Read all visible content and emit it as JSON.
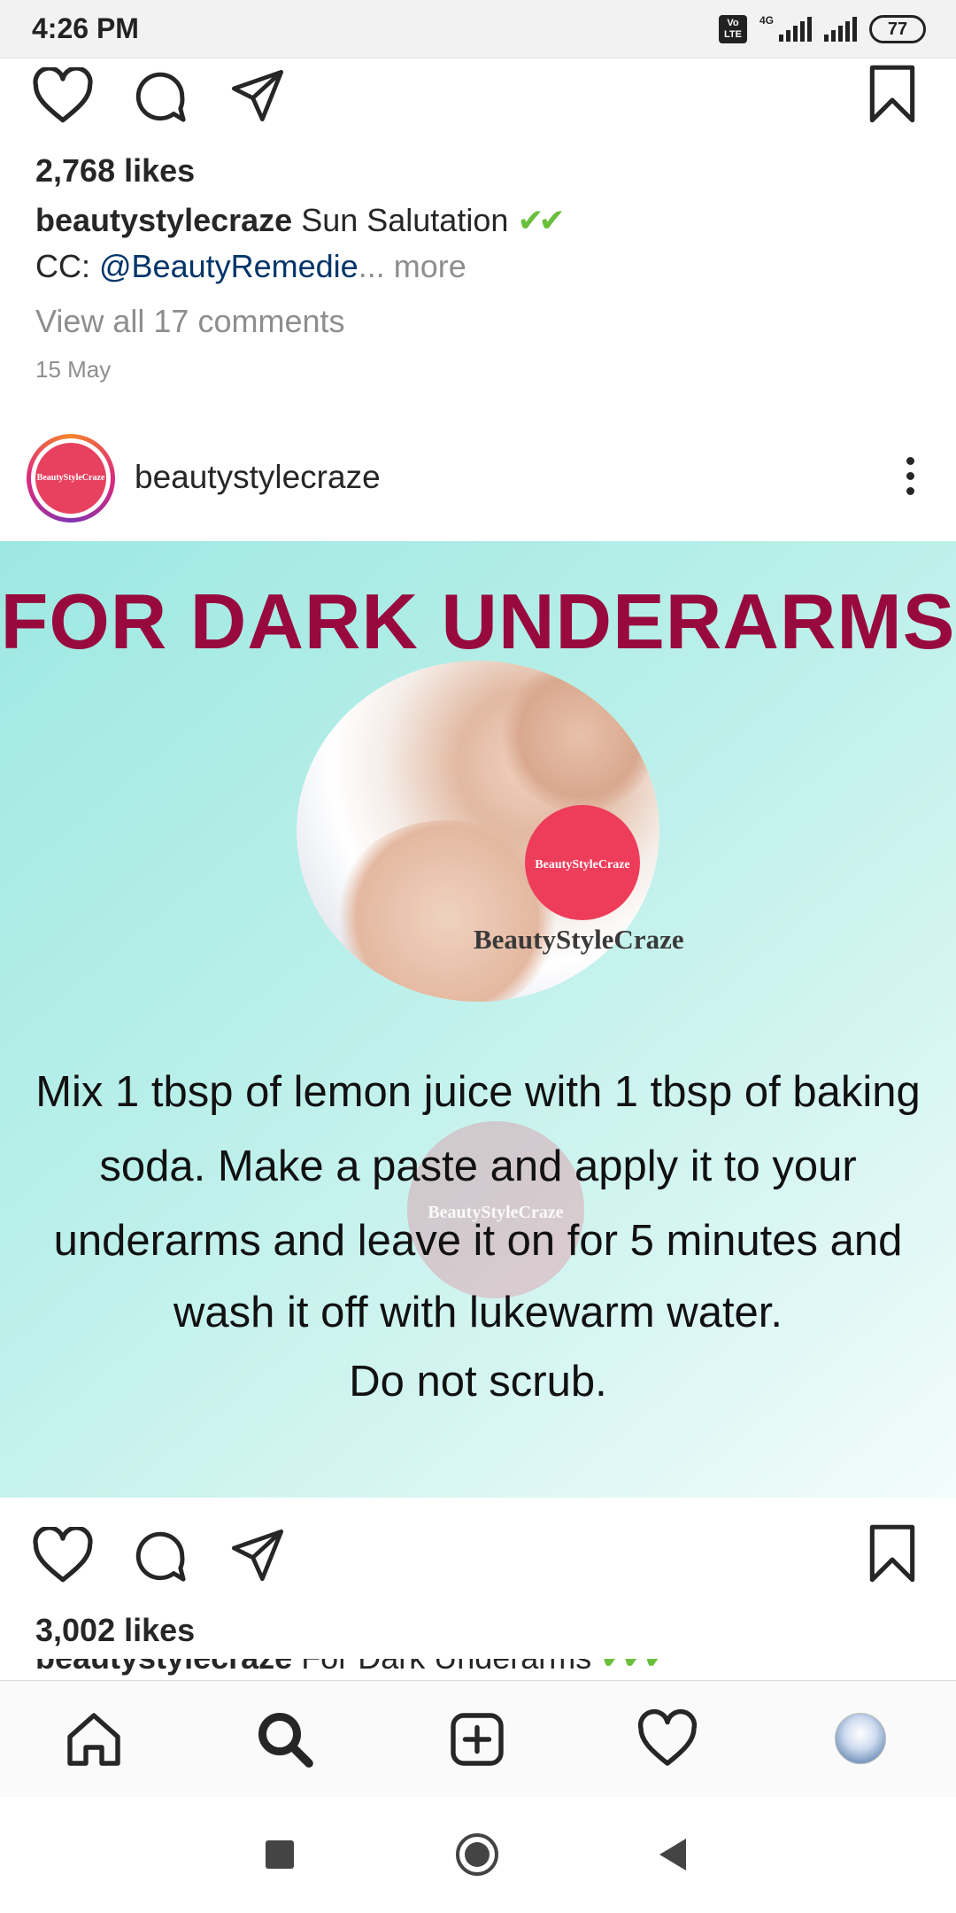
{
  "status_bar": {
    "time": "4:26 PM",
    "volte": "Vo\nLTE",
    "network": "4G",
    "battery": "77"
  },
  "post1": {
    "likes": "2,768 likes",
    "username": "beautystylecraze",
    "caption": "Sun Salutation",
    "caption_emoji": "✔✔",
    "cc_prefix": "CC: ",
    "cc_handle": "@BeautyRemedie",
    "cc_more": "... more",
    "view_comments": "View all 17 comments",
    "date": "15 May"
  },
  "post2": {
    "username": "beautystylecraze",
    "avatar_text": "BeautyStyleCraze",
    "image": {
      "title": "FOR DARK UNDERARMS",
      "logo_badge": "BeautyStyleCraze",
      "logo_text": "BeautyStyleCraze",
      "body_lines": [
        "Mix 1 tbsp of lemon juice with 1 tbsp of baking",
        "soda. Make a paste and apply it to your",
        "underarms and leave it on for 5 minutes and",
        "wash it off with lukewarm water.",
        "Do not scrub."
      ],
      "watermark": "BeautyStyleCraze",
      "colors": {
        "title": "#980a3e",
        "badge": "#ee3d5b"
      }
    },
    "likes": "3,002 likes",
    "caption_user": "beautystylecraze",
    "caption": "For Dark Underarms",
    "caption_emoji": "✔✔✔"
  },
  "bottom_nav": {
    "items": [
      "home-icon",
      "search-icon",
      "add-post-icon",
      "activity-heart-icon",
      "profile-avatar"
    ]
  }
}
